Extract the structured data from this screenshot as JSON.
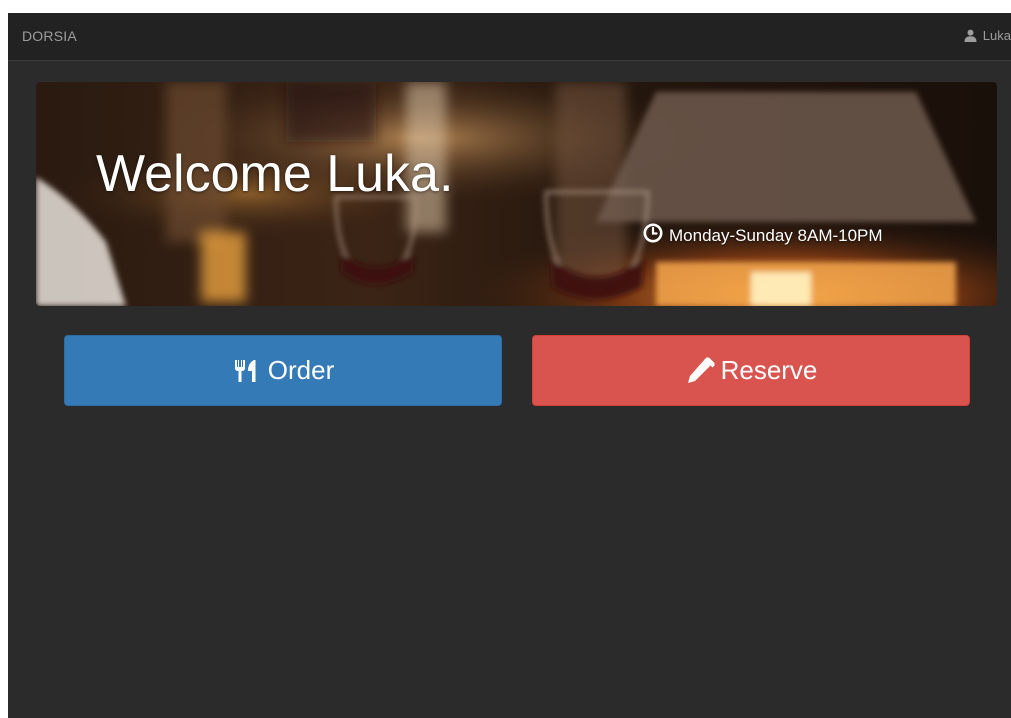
{
  "navbar": {
    "brand": "DORSIA",
    "user_name": "Luka",
    "user_icon": "user-icon"
  },
  "hero": {
    "title": "Welcome Luka.",
    "hours_icon": "clock-icon",
    "hours": "Monday-Sunday 8AM-10PM"
  },
  "actions": {
    "order_label": "Order",
    "order_icon": "cutlery-icon",
    "reserve_label": "Reserve",
    "reserve_icon": "pencil-icon"
  },
  "colors": {
    "background": "#2b2b2b",
    "navbar": "#222222",
    "order_button": "#337ab7",
    "reserve_button": "#d9534f"
  }
}
